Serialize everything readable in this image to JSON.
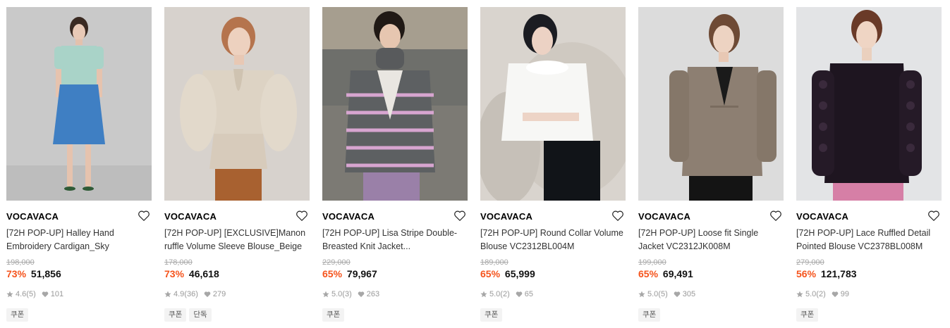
{
  "products": [
    {
      "brand": "VOCAVACA",
      "name_line1": "[72H POP-UP] Halley Hand",
      "name_line2": "Embroidery Cardigan_Sky",
      "original_price": "198,000",
      "discount": "73%",
      "price": "51,856",
      "rating": "4.6",
      "reviews": "(5)",
      "likes": "101",
      "tags": [
        "쿠폰"
      ]
    },
    {
      "brand": "VOCAVACA",
      "name_line1": "[72H POP-UP] [EXCLUSIVE]Manon",
      "name_line2": "ruffle Volume Sleeve Blouse_Beige",
      "original_price": "178,000",
      "discount": "73%",
      "price": "46,618",
      "rating": "4.9",
      "reviews": "(36)",
      "likes": "279",
      "tags": [
        "쿠폰",
        "단독"
      ]
    },
    {
      "brand": "VOCAVACA",
      "name_line1": "[72H POP-UP] Lisa Stripe Double-",
      "name_line2": "Breasted Knit Jacket...",
      "original_price": "229,000",
      "discount": "65%",
      "price": "79,967",
      "rating": "5.0",
      "reviews": "(3)",
      "likes": "263",
      "tags": [
        "쿠폰"
      ]
    },
    {
      "brand": "VOCAVACA",
      "name_line1": "[72H POP-UP] Round Collar Volume",
      "name_line2": "Blouse VC2312BL004M",
      "original_price": "189,000",
      "discount": "65%",
      "price": "65,999",
      "rating": "5.0",
      "reviews": "(2)",
      "likes": "65",
      "tags": [
        "쿠폰"
      ]
    },
    {
      "brand": "VOCAVACA",
      "name_line1": "[72H POP-UP] Loose fit Single",
      "name_line2": "Jacket VC2312JK008M",
      "original_price": "199,000",
      "discount": "65%",
      "price": "69,491",
      "rating": "5.0",
      "reviews": "(5)",
      "likes": "305",
      "tags": [
        "쿠폰"
      ]
    },
    {
      "brand": "VOCAVACA",
      "name_line1": "[72H POP-UP] Lace Ruffled Detail",
      "name_line2": "Pointed Blouse VC2378BL008M",
      "original_price": "279,000",
      "discount": "56%",
      "price": "121,783",
      "rating": "5.0",
      "reviews": "(2)",
      "likes": "99",
      "tags": [
        "쿠폰"
      ]
    }
  ],
  "colors": {
    "discount": "#f5541d",
    "muted": "#999999",
    "tag_bg": "#f3f3f3"
  },
  "icons": {
    "wishlist": "heart-outline-icon",
    "rating": "star-icon",
    "likes": "heart-filled-icon"
  }
}
